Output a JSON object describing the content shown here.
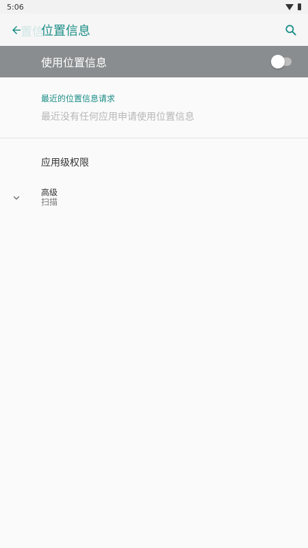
{
  "status_bar": {
    "time": "5:06"
  },
  "toolbar": {
    "ghost_title": "置信",
    "title": "位置信息"
  },
  "master_switch": {
    "label": "使用位置信息",
    "on": false
  },
  "recent_section": {
    "header": "最近的位置信息请求",
    "empty_text": "最近没有任何应用申请使用位置信息"
  },
  "app_permissions": {
    "label": "应用级权限"
  },
  "advanced": {
    "title": "高级",
    "summary": "扫描"
  },
  "colors": {
    "accent": "#1a8d86",
    "switch_bar": "#8a8d8f"
  }
}
